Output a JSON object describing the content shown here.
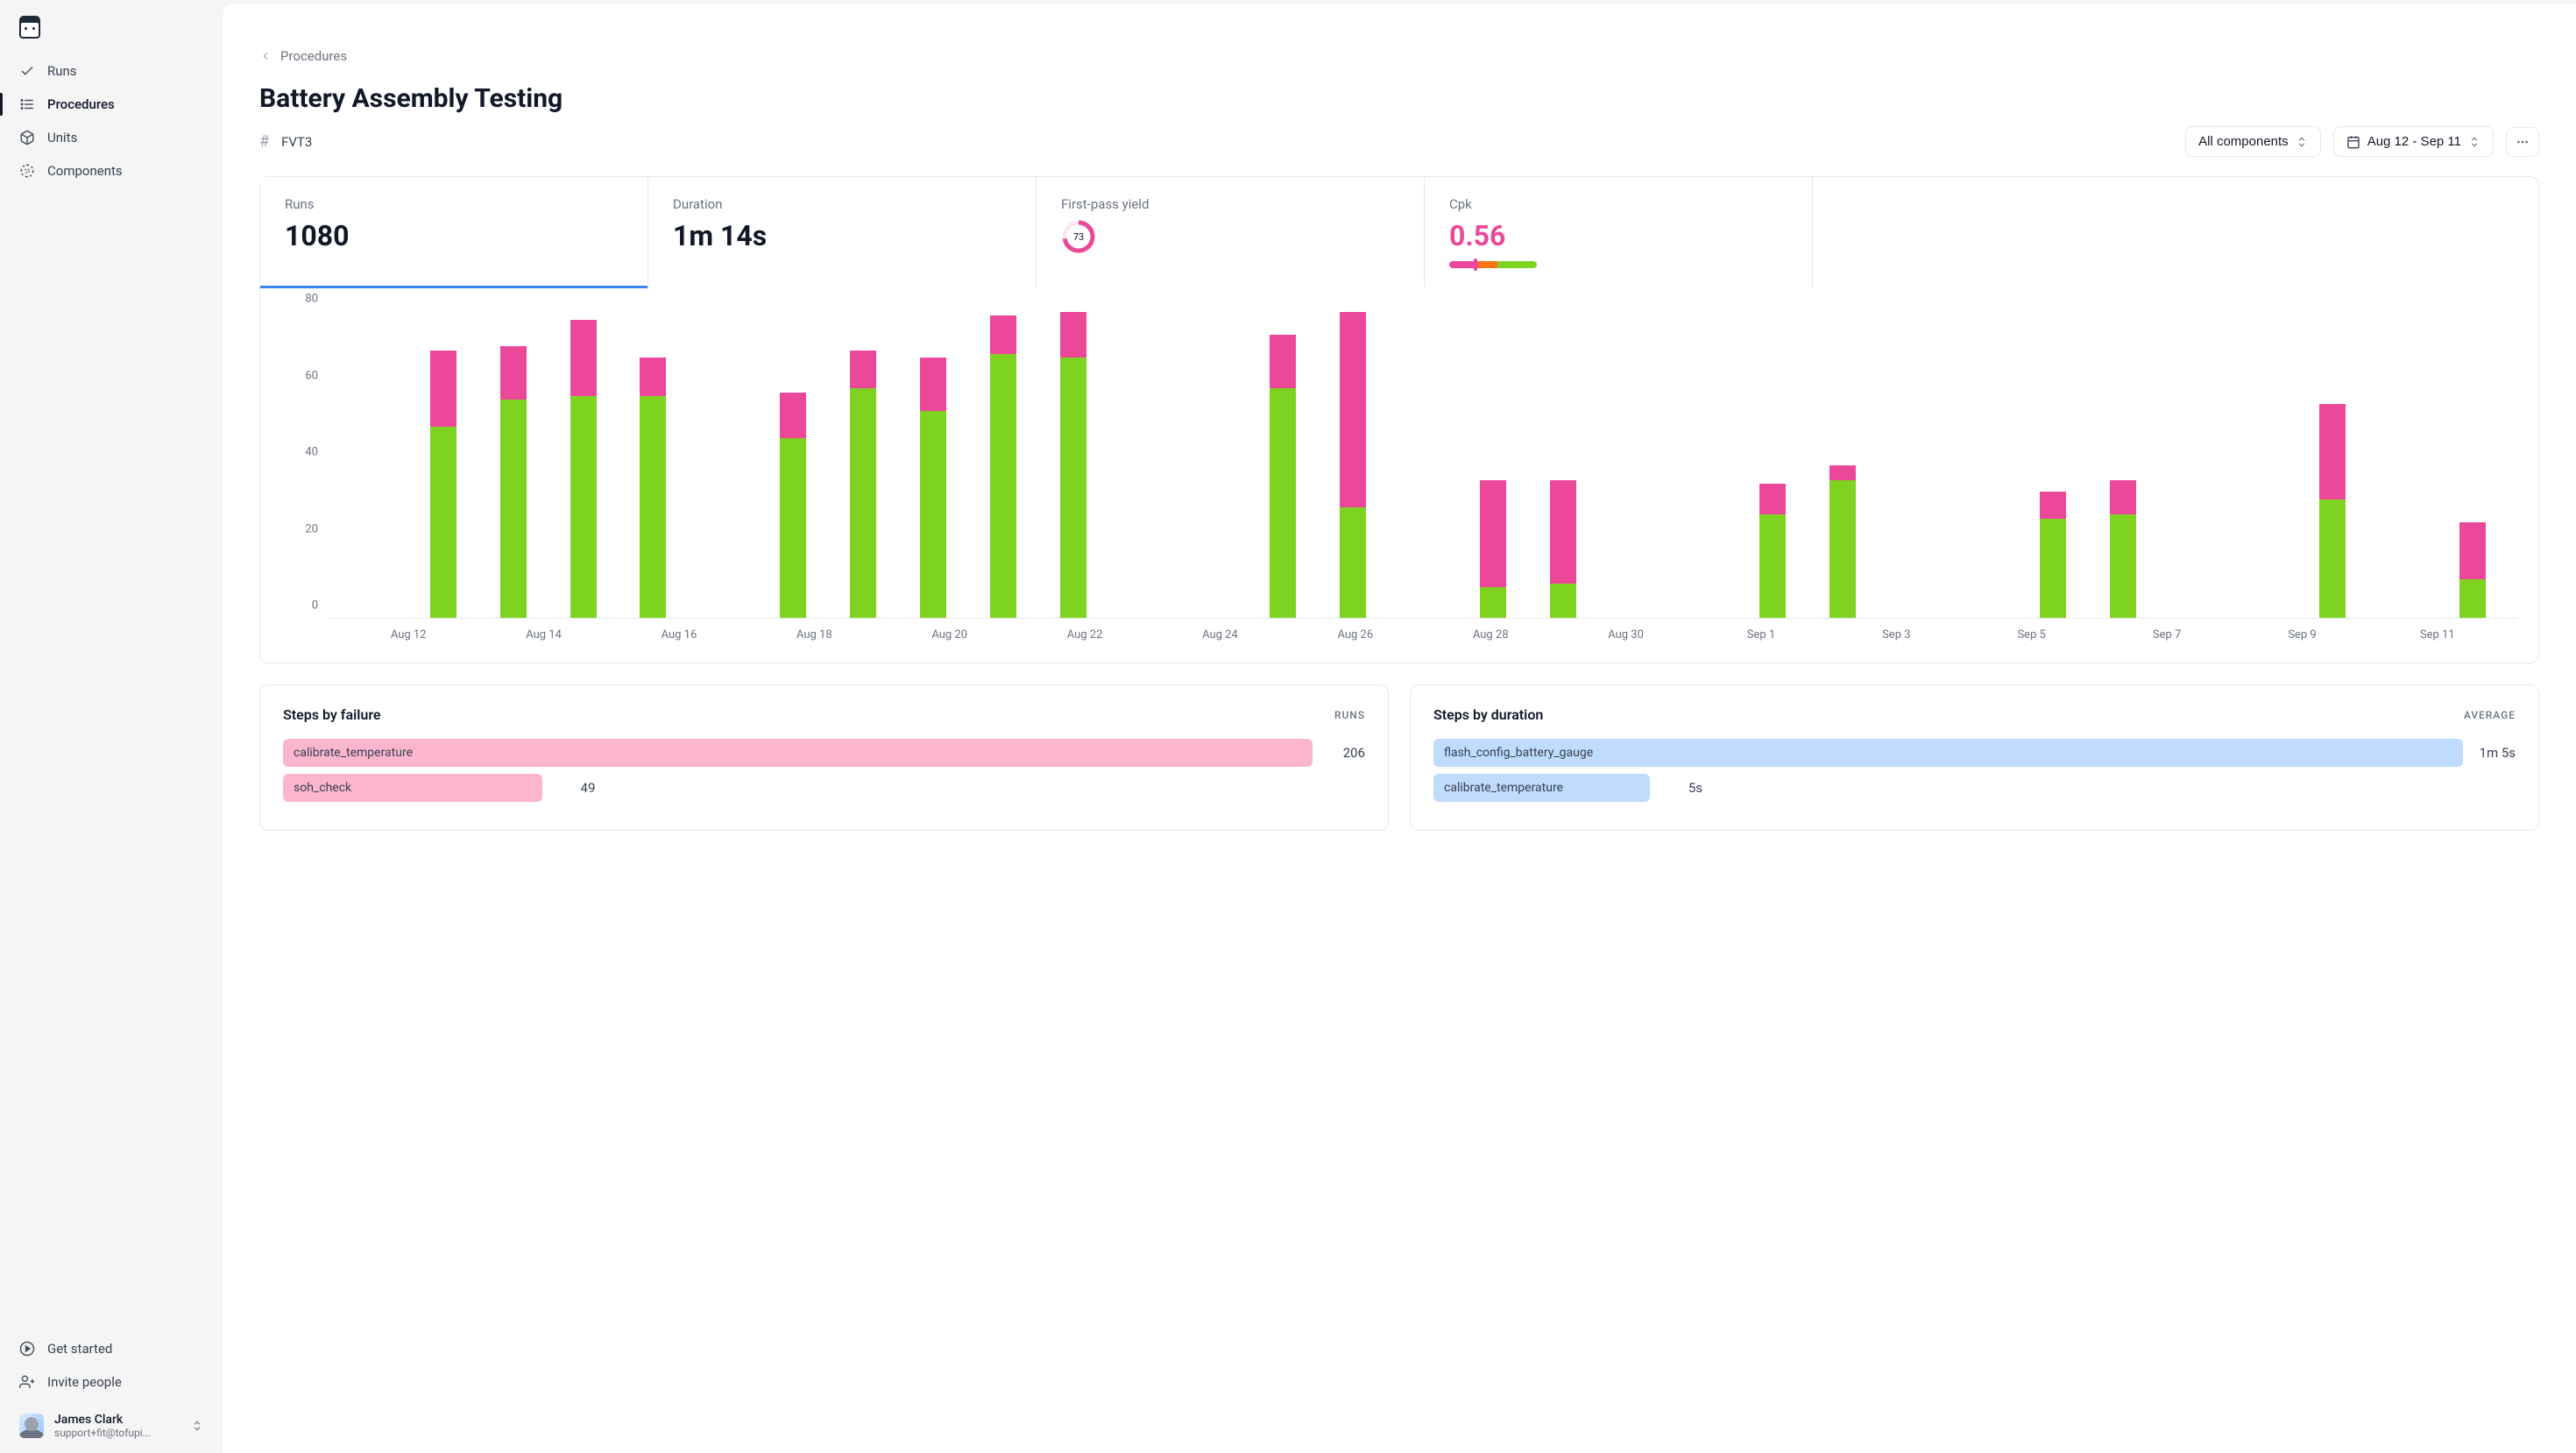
{
  "sidebar": {
    "items": [
      {
        "label": "Runs",
        "icon": "check-icon"
      },
      {
        "label": "Procedures",
        "icon": "list-icon"
      },
      {
        "label": "Units",
        "icon": "box-icon"
      },
      {
        "label": "Components",
        "icon": "target-icon"
      }
    ],
    "footer": [
      {
        "label": "Get started",
        "icon": "play-icon"
      },
      {
        "label": "Invite people",
        "icon": "user-plus-icon"
      }
    ],
    "user": {
      "name": "James Clark",
      "email": "support+fit@tofupi..."
    }
  },
  "breadcrumb": {
    "parent": "Procedures"
  },
  "page": {
    "title": "Battery Assembly Testing",
    "code": "FVT3"
  },
  "controls": {
    "components_label": "All components",
    "date_range": "Aug 12 - Sep 11"
  },
  "stats": {
    "runs": {
      "label": "Runs",
      "value": "1080"
    },
    "duration": {
      "label": "Duration",
      "value": "1m 14s"
    },
    "yield": {
      "label": "First-pass yield",
      "value": "73"
    },
    "cpk": {
      "label": "Cpk",
      "value": "0.56"
    }
  },
  "chart_data": {
    "type": "bar",
    "categories": [
      "Aug 12",
      "Aug 13",
      "Aug 14",
      "Aug 15",
      "Aug 16",
      "Aug 17",
      "Aug 18",
      "Aug 19",
      "Aug 20",
      "Aug 21",
      "Aug 22",
      "Aug 23",
      "Aug 24",
      "Aug 25",
      "Aug 26",
      "Aug 27",
      "Aug 28",
      "Aug 29",
      "Aug 30",
      "Aug 31",
      "Sep 1",
      "Sep 2",
      "Sep 3",
      "Sep 4",
      "Sep 5",
      "Sep 6",
      "Sep 7",
      "Sep 8",
      "Sep 9",
      "Sep 10",
      "Sep 11"
    ],
    "x_tick_labels": [
      "Aug 12",
      "Aug 14",
      "Aug 16",
      "Aug 18",
      "Aug 20",
      "Aug 22",
      "Aug 24",
      "Aug 26",
      "Aug 28",
      "Aug 30",
      "Sep 1",
      "Sep 3",
      "Sep 5",
      "Sep 7",
      "Sep 9",
      "Sep 11"
    ],
    "series": [
      {
        "name": "pass",
        "color": "#7ed321",
        "values": [
          0,
          50,
          57,
          58,
          58,
          0,
          47,
          60,
          54,
          69,
          69,
          0,
          0,
          60,
          29,
          0,
          8,
          9,
          0,
          0,
          27,
          36,
          0,
          0,
          26,
          27,
          0,
          0,
          31,
          0,
          10
        ]
      },
      {
        "name": "fail",
        "color": "#ec4899",
        "values": [
          0,
          20,
          14,
          20,
          10,
          0,
          12,
          10,
          14,
          10,
          12,
          0,
          0,
          14,
          51,
          0,
          28,
          27,
          0,
          0,
          8,
          4,
          0,
          0,
          7,
          9,
          0,
          0,
          25,
          0,
          15
        ]
      }
    ],
    "ylim": [
      0,
      80
    ],
    "y_ticks": [
      0,
      20,
      40,
      60,
      80
    ]
  },
  "panels": {
    "failure": {
      "title": "Steps by failure",
      "metric": "RUNS",
      "rows": [
        {
          "label": "calibrate_temperature",
          "value": "206",
          "width": 100
        },
        {
          "label": "soh_check",
          "value": "49",
          "width": 24
        }
      ]
    },
    "duration": {
      "title": "Steps by duration",
      "metric": "AVERAGE",
      "rows": [
        {
          "label": "flash_config_battery_gauge",
          "value": "1m 5s",
          "width": 100
        },
        {
          "label": "calibrate_temperature",
          "value": "5s",
          "width": 20
        }
      ]
    }
  }
}
